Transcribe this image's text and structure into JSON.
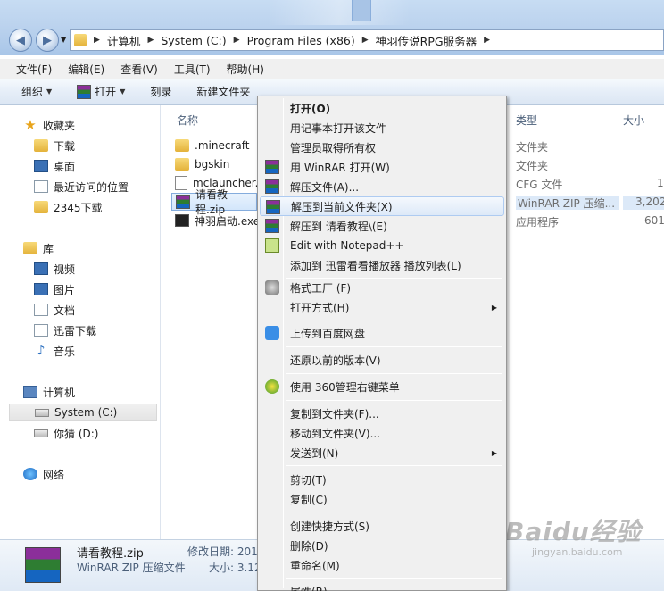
{
  "address": {
    "crumbs": [
      "计算机",
      "System (C:)",
      "Program Files (x86)",
      "神羽传说RPG服务器"
    ]
  },
  "menubar": [
    "文件(F)",
    "编辑(E)",
    "查看(V)",
    "工具(T)",
    "帮助(H)"
  ],
  "toolbar": {
    "organize": "组织",
    "open": "打开",
    "record": "刻录",
    "new_folder": "新建文件夹"
  },
  "nav": {
    "favorites": "收藏夹",
    "fav_items": [
      "下载",
      "桌面",
      "最近访问的位置",
      "2345下载"
    ],
    "libraries": "库",
    "lib_items": [
      "视频",
      "图片",
      "文档",
      "迅雷下载",
      "音乐"
    ],
    "computer": "计算机",
    "drives": [
      "System (C:)",
      "你猜 (D:)"
    ],
    "network": "网络"
  },
  "columns": {
    "name": "名称",
    "type": "类型",
    "size": "大小"
  },
  "files": [
    {
      "name": ".minecraft",
      "type": "文件夹",
      "size": ""
    },
    {
      "name": "bgskin",
      "type": "文件夹",
      "size": ""
    },
    {
      "name": "mclauncher.",
      "type": "CFG 文件",
      "size": "1"
    },
    {
      "name": "请看教程.zip",
      "type": "WinRAR ZIP 压缩...",
      "size": "3,202"
    },
    {
      "name": "神羽启动.exe",
      "type": "应用程序",
      "size": "601"
    }
  ],
  "status": {
    "filename": "请看教程.zip",
    "filetype": "WinRAR ZIP 压缩文件",
    "modified_label": "修改日期: 201",
    "size_label": "大小: 3.12"
  },
  "context_menu": {
    "items": [
      "打开(O)",
      "用记事本打开该文件",
      "管理员取得所有权",
      "用 WinRAR 打开(W)",
      "解压文件(A)...",
      "解压到当前文件夹(X)",
      "解压到 请看教程\\(E)",
      "Edit with Notepad++",
      "添加到 迅雷看看播放器 播放列表(L)",
      "格式工厂 (F)",
      "打开方式(H)",
      "上传到百度网盘",
      "还原以前的版本(V)",
      "使用 360管理右键菜单",
      "复制到文件夹(F)...",
      "移动到文件夹(V)...",
      "发送到(N)",
      "剪切(T)",
      "复制(C)",
      "创建快捷方式(S)",
      "删除(D)",
      "重命名(M)",
      "属性(R)"
    ]
  },
  "watermark": {
    "line1": "Baidu经验",
    "line2": "jingyan.baidu.com"
  }
}
